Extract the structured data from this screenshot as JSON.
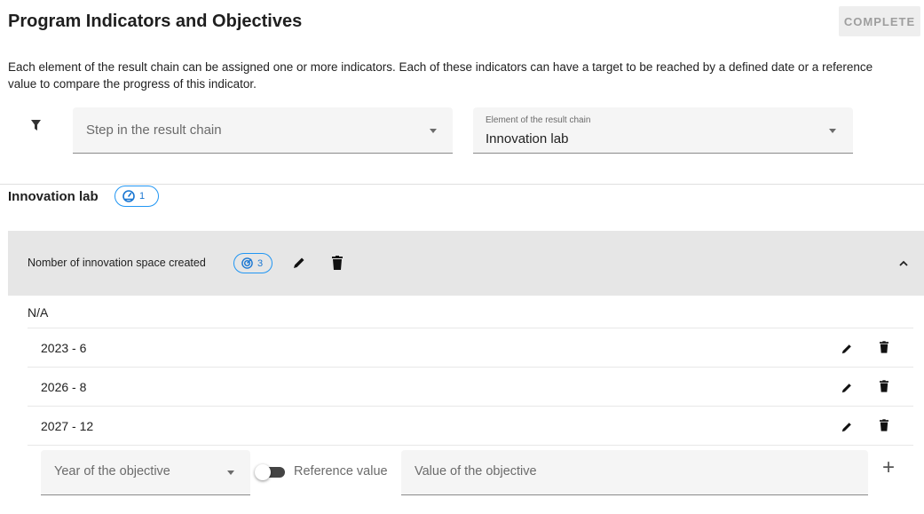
{
  "header": {
    "title": "Program Indicators and Objectives",
    "complete_label": "COMPLETE"
  },
  "description": "Each element of the result chain can be assigned one or more indicators. Each of these indicators can have a target to be reached by a defined date or a reference value to compare the progress of this indicator.",
  "filters": {
    "icon": "filter-icon",
    "step": {
      "placeholder": "Step in the result chain"
    },
    "element": {
      "label": "Element of the result chain",
      "value": "Innovation lab"
    }
  },
  "section": {
    "title": "Innovation lab",
    "badge_icon": "speedometer-icon",
    "badge_count": "1"
  },
  "indicator": {
    "title": "Nomber of innovation space created",
    "badge_icon": "target-icon",
    "badge_count": "3",
    "baseline": "N/A",
    "objectives": [
      {
        "label": "2023 - 6"
      },
      {
        "label": "2026 - 8"
      },
      {
        "label": "2027 - 12"
      }
    ]
  },
  "new_objective": {
    "year_placeholder": "Year of the objective",
    "reference_label": "Reference value",
    "value_placeholder": "Value of the objective",
    "add_symbol": "+"
  },
  "colors": {
    "accent": "#2196f3",
    "panel_header_bg": "#e6e6e6",
    "field_bg": "#f5f5f5"
  }
}
